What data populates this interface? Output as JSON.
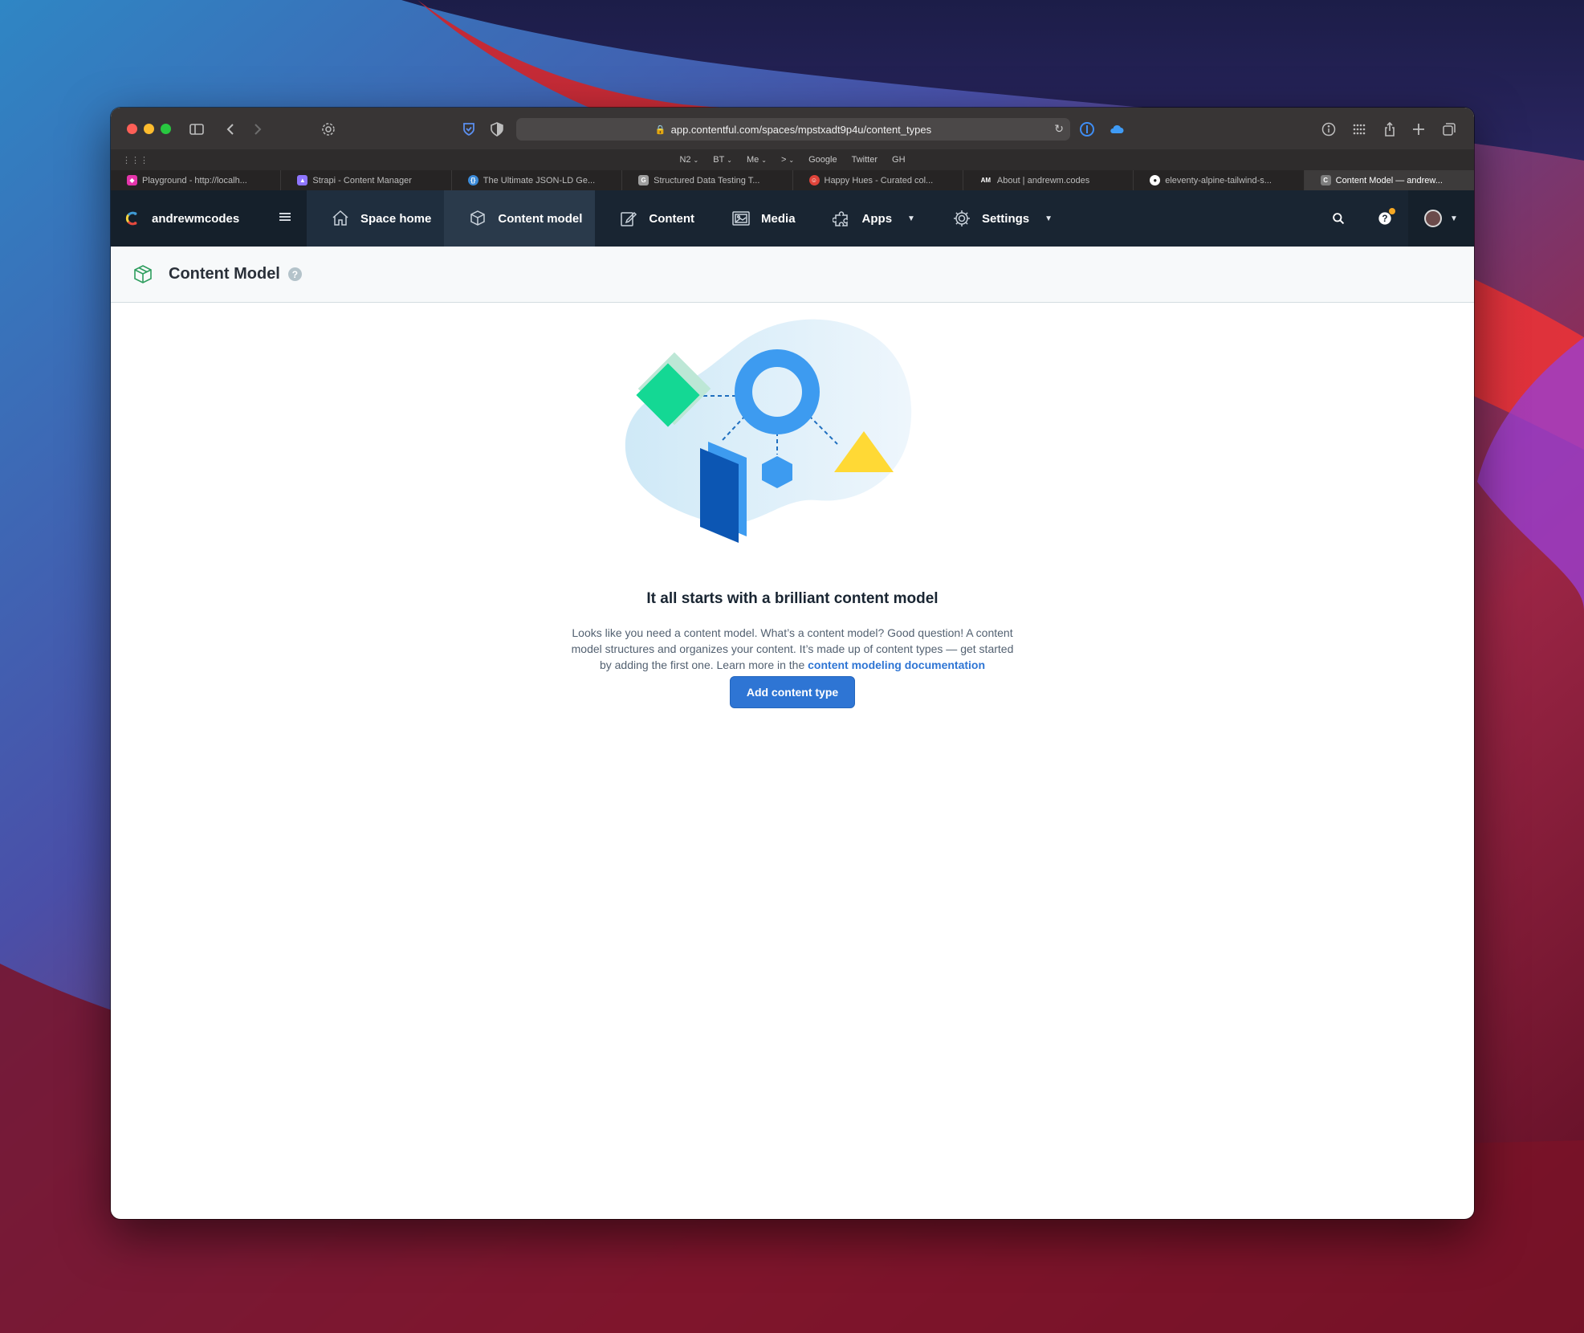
{
  "browser": {
    "url": "app.contentful.com/spaces/mpstxadt9p4u/content_types",
    "favorites": [
      {
        "label": "N2",
        "has_chevron": true
      },
      {
        "label": "BT",
        "has_chevron": true
      },
      {
        "label": "Me",
        "has_chevron": true
      },
      {
        "label": ">",
        "has_chevron": true
      },
      {
        "label": "Google",
        "has_chevron": false
      },
      {
        "label": "Twitter",
        "has_chevron": false
      },
      {
        "label": "GH",
        "has_chevron": false
      }
    ],
    "tabs": [
      {
        "title": "Playground - http://localh...",
        "icon_color": "#e535ab",
        "icon": "graphql-icon"
      },
      {
        "title": "Strapi - Content Manager",
        "icon_color": "#8e75ff",
        "icon": "strapi-icon"
      },
      {
        "title": "The Ultimate JSON-LD Ge...",
        "icon_color": "#3b8bd9",
        "icon": "jsonld-icon"
      },
      {
        "title": "Structured Data Testing T...",
        "icon_color": "#9e9e9e",
        "icon": "google-icon"
      },
      {
        "title": "Happy Hues - Curated col...",
        "icon_color": "#e0443a",
        "icon": "happyhues-icon"
      },
      {
        "title": "About | andrewm.codes",
        "icon_color": "#262424",
        "icon": "am-icon",
        "icon_text": "AM"
      },
      {
        "title": "eleventy-alpine-tailwind-s...",
        "icon_color": "#ffffff",
        "icon": "github-icon"
      },
      {
        "title": "Content Model — andrew...",
        "icon_color": "#7d7d7d",
        "icon": "contentful-icon",
        "icon_text": "C",
        "active": true
      }
    ]
  },
  "nav": {
    "space_name": "andrewmcodes",
    "items": [
      {
        "label": "Space home",
        "icon": "home-icon"
      },
      {
        "label": "Content model",
        "icon": "content-model-icon",
        "active": true
      },
      {
        "label": "Content",
        "icon": "edit-icon"
      },
      {
        "label": "Media",
        "icon": "media-icon"
      },
      {
        "label": "Apps",
        "icon": "puzzle-icon",
        "has_dropdown": true
      },
      {
        "label": "Settings",
        "icon": "gear-icon",
        "has_dropdown": true
      }
    ]
  },
  "page": {
    "title": "Content Model"
  },
  "empty_state": {
    "heading": "It all starts with a brilliant content model",
    "description": "Looks like you need a content model. What’s a content model? Good question! A content model structures and organizes your content. It’s made up of content types — get started by adding the first one. Learn more in the",
    "link_text": "content modeling documentation",
    "button_label": "Add content type"
  },
  "colors": {
    "nav_bg": "#192532",
    "primary_button": "#2e75d4",
    "link": "#2e75d4",
    "header_bg": "#f7f9fa"
  }
}
